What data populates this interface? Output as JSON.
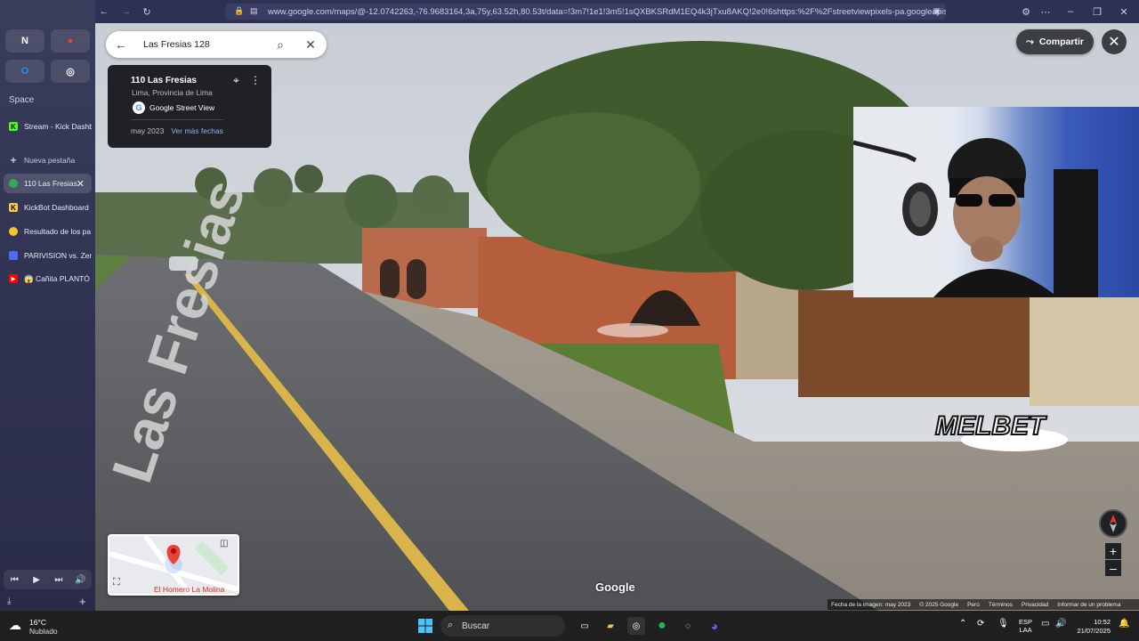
{
  "browser": {
    "url": "www.google.com/maps/@-12.0742263,-76.9683164,3a,75y,63.52h,80.53t/data=!3m7!1e1!3m5!1sQXBKSRdM1EQ4k3jTxu8AKQ!2e0!6shttps:%2F%2Fstreetviewpixels-pa.googleapis.com"
  },
  "sidebar": {
    "space_label": "Space",
    "tabs": [
      {
        "label": "Stream - Kick Dashb",
        "color": "#53fc18",
        "glyph": "K"
      },
      {
        "label": "Nueva pestaña",
        "color": "",
        "glyph": "+"
      },
      {
        "label": "110 Las Fresias",
        "color": "#34a853",
        "glyph": "",
        "active": true
      },
      {
        "label": "KickBot Dashboard",
        "color": "#f4d03f",
        "glyph": "K"
      },
      {
        "label": "Resultado de los pa",
        "color": "#f4c430",
        "glyph": ""
      },
      {
        "label": "PARIVISION vs. Zen",
        "color": "#4a6cf7",
        "glyph": ""
      },
      {
        "label": "😱 Cañita PLANTÓ",
        "color": "#ff0000",
        "glyph": "▶"
      }
    ]
  },
  "maps": {
    "search_value": "Las Fresias 128",
    "info_card": {
      "title": "110 Las Fresias",
      "subtitle": "Lima, Provincia de Lima",
      "source": "Google Street View",
      "date": "may 2023",
      "more_dates": "Ver más fechas"
    },
    "share_label": "Compartir",
    "minimap_label": "El Homero La Molina",
    "google_logo": "Google",
    "footer": [
      "Fecha de la imagen: may 2023",
      "© 2025 Google",
      "Perú",
      "Términos",
      "Privacidad",
      "Informar de un problema"
    ],
    "street_text": "Las Fresias",
    "overlay_logo": "MELBET"
  },
  "taskbar": {
    "temperature": "16°C",
    "weather": "Nublado",
    "search_placeholder": "Buscar",
    "lang_line1": "ESP",
    "lang_line2": "LAA",
    "time": "10:52",
    "date": "21/07/2025"
  }
}
